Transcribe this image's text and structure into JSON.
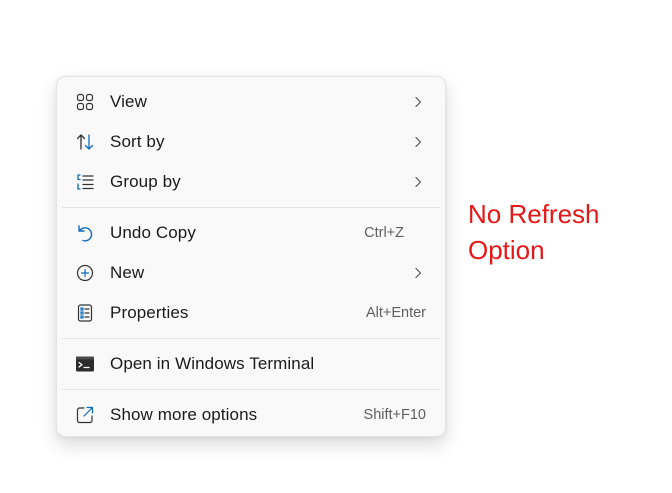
{
  "menu": {
    "items": [
      {
        "label": "View",
        "icon": "view-grid-icon"
      },
      {
        "label": "Sort by",
        "icon": "sort-arrows-icon"
      },
      {
        "label": "Group by",
        "icon": "group-list-icon"
      },
      {
        "label": "Undo Copy",
        "shortcut": "Ctrl+Z",
        "icon": "undo-icon"
      },
      {
        "label": "New",
        "icon": "new-plus-icon"
      },
      {
        "label": "Properties",
        "shortcut": "Alt+Enter",
        "icon": "properties-icon"
      },
      {
        "label": "Open in Windows Terminal",
        "icon": "terminal-icon"
      },
      {
        "label": "Show more options",
        "shortcut": "Shift+F10",
        "icon": "show-more-icon"
      }
    ]
  },
  "annotation": {
    "text": "No Refresh Option",
    "color": "#e51717"
  },
  "colors": {
    "accent": "#0f6cbd",
    "menu_background": "#f9f9f9"
  }
}
